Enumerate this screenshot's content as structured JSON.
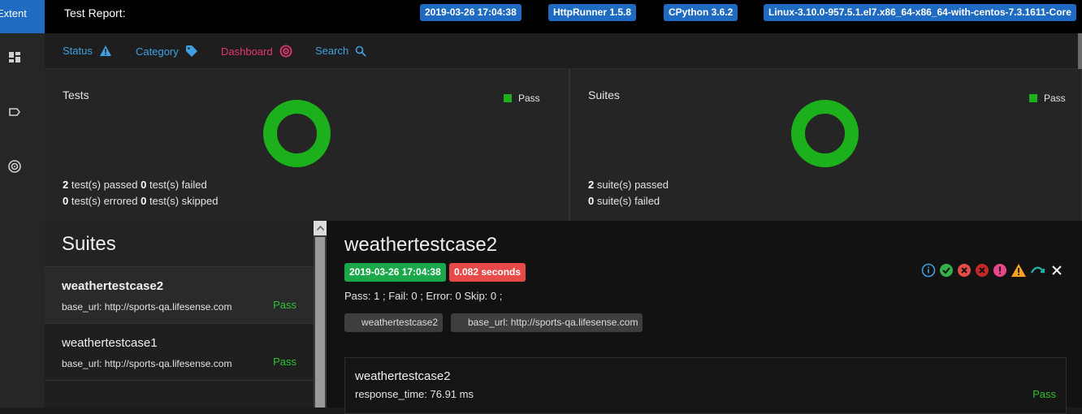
{
  "brand": "Extent",
  "header": {
    "title": "Test Report:",
    "chips": [
      "2019-03-26 17:04:38",
      "HttpRunner 1.5.8",
      "CPython 3.6.2",
      "Linux-3.10.0-957.5.1.el7.x86_64-x86_64-with-centos-7.3.1611-Core"
    ]
  },
  "nav": [
    {
      "label": "Status",
      "icon": "warning-icon"
    },
    {
      "label": "Category",
      "icon": "tag-icon"
    },
    {
      "label": "Dashboard",
      "icon": "dashboard-icon"
    },
    {
      "label": "Search",
      "icon": "search-icon"
    }
  ],
  "tests_panel": {
    "title": "Tests",
    "legend": "Pass",
    "line1": {
      "passed": "2",
      "passed_label": " test(s) passed ",
      "failed": "0",
      "failed_label": " test(s) failed"
    },
    "line2": {
      "errored": "0",
      "errored_label": " test(s) errored ",
      "skipped": "0",
      "skipped_label": " test(s) skipped"
    },
    "pass_fraction": 1.0
  },
  "suites_panel": {
    "title": "Suites",
    "legend": "Pass",
    "line1": {
      "passed": "2",
      "passed_label": " suite(s) passed"
    },
    "line2": {
      "failed": "0",
      "failed_label": " suite(s) failed"
    },
    "pass_fraction": 1.0
  },
  "suites": {
    "heading": "Suites",
    "items": [
      {
        "name": "weathertestcase2",
        "url": "base_url: http://sports-qa.lifesense.com",
        "status": "Pass"
      },
      {
        "name": "weathertestcase1",
        "url": "base_url: http://sports-qa.lifesense.com",
        "status": "Pass"
      }
    ]
  },
  "detail": {
    "title": "weathertestcase2",
    "time_badge": "2019-03-26 17:04:38",
    "duration_badge": "0.082 seconds",
    "counts": "Pass: 1 ; Fail: 0 ; Error: 0 Skip: 0 ;",
    "tags": [
      "weathertestcase2",
      "base_url: http://sports-qa.lifesense.com"
    ],
    "node": {
      "name": "weathertestcase2",
      "response": "response_time: 76.91 ms",
      "status": "Pass"
    }
  },
  "colors": {
    "pass": "#1cb11c",
    "accent": "#1e6bc1",
    "link": "#3fa0e2",
    "active": "#e5366d",
    "fail": "#e84a4a"
  }
}
